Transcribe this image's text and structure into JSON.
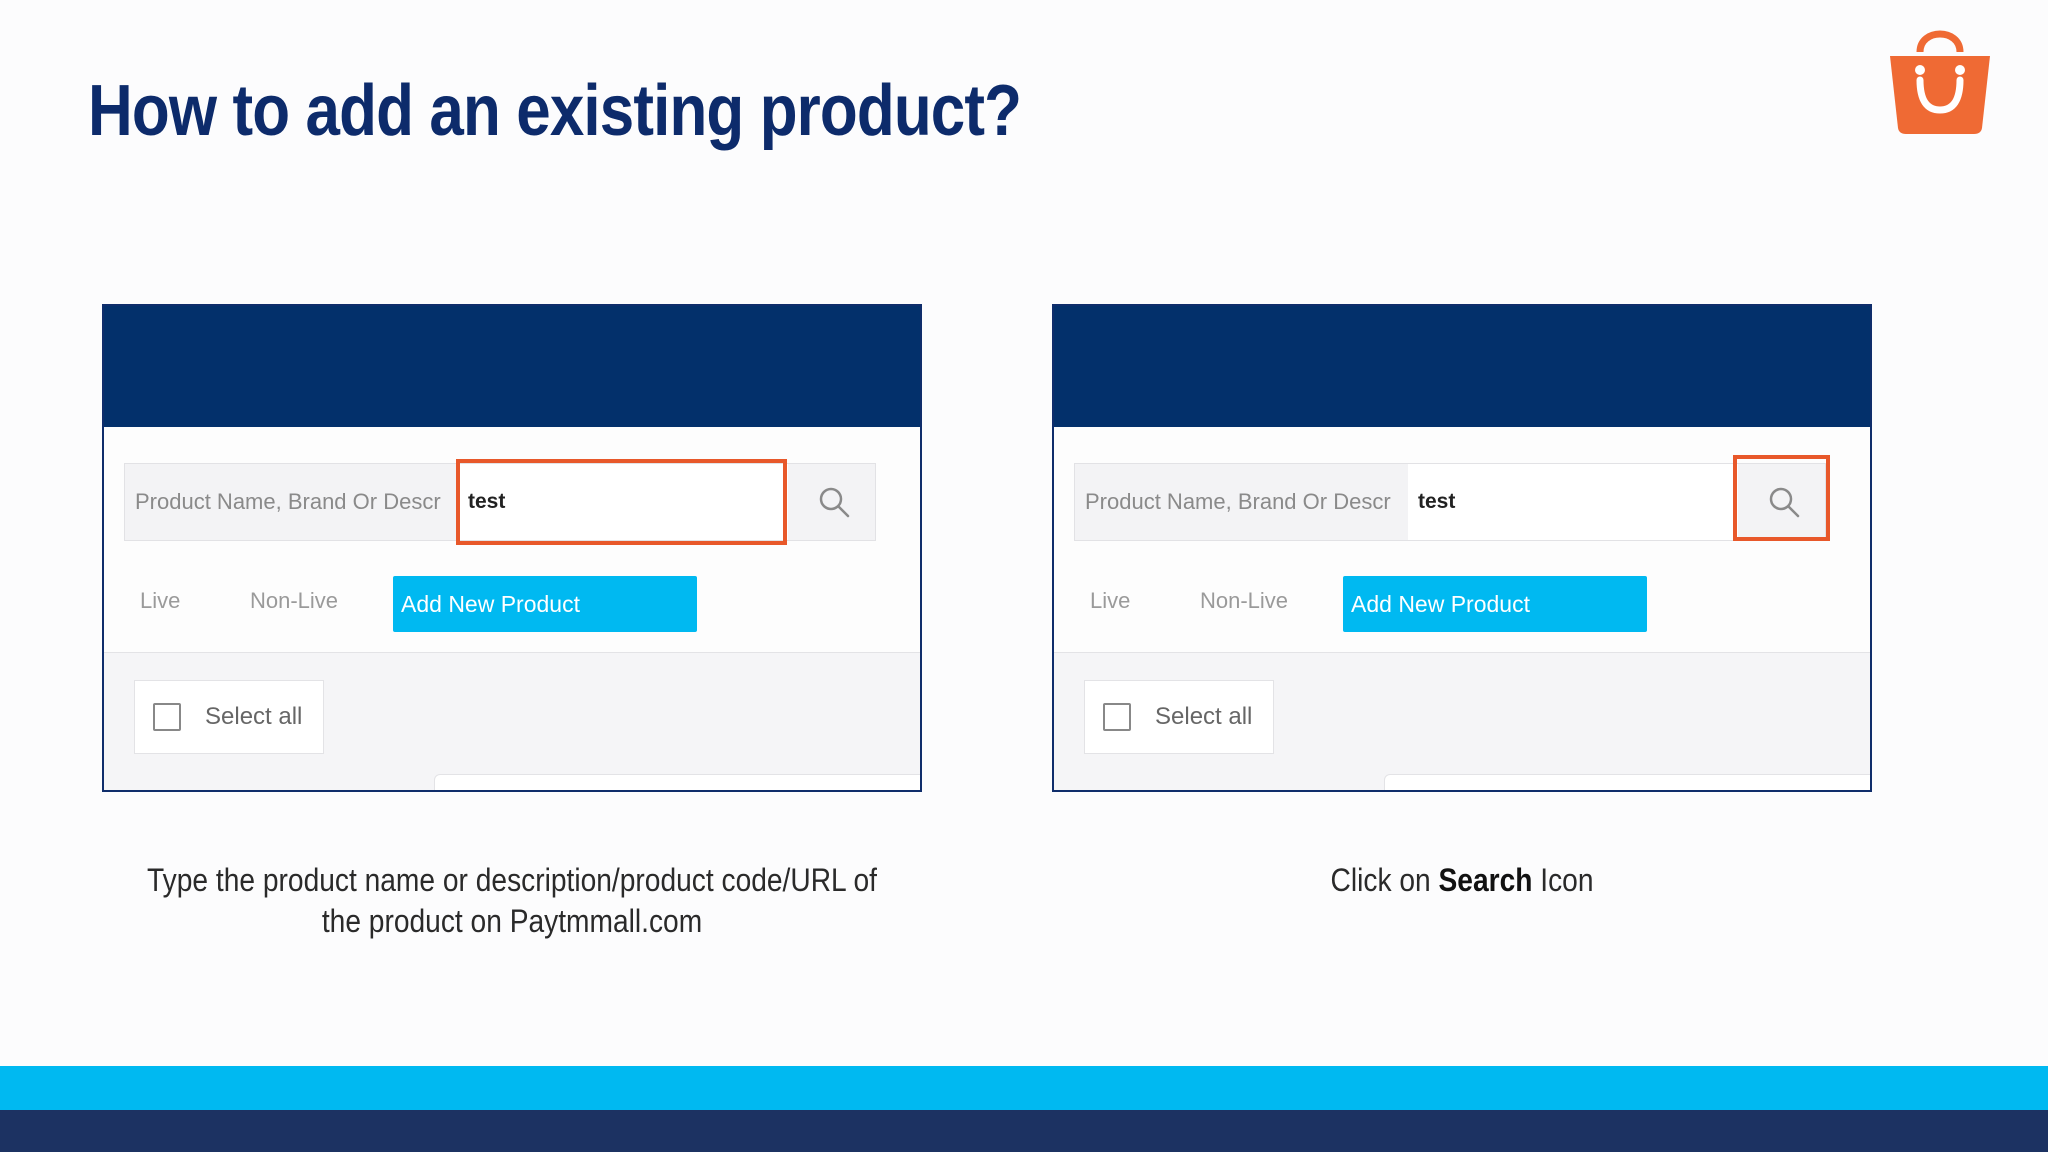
{
  "slide": {
    "title": "How to add an existing product?",
    "colors": {
      "title": "#0d2b6b",
      "accent_orange": "#e8582a",
      "accent_cyan": "#00b9f1",
      "navy": "#1c3262"
    },
    "logo_icon": "shopping-bag-smile-icon"
  },
  "screenshots": [
    {
      "search_placeholder": "Product Name, Brand Or Descr",
      "search_value": "test",
      "search_icon": "search-icon",
      "tabs": [
        "Live",
        "Non-Live"
      ],
      "add_button": "Add New Product",
      "select_all": "Select all",
      "highlighted": "search-input"
    },
    {
      "search_placeholder": "Product Name, Brand Or Descr",
      "search_value": "test",
      "search_icon": "search-icon",
      "tabs": [
        "Live",
        "Non-Live"
      ],
      "add_button": "Add New Product",
      "select_all": "Select all",
      "highlighted": "search-button"
    }
  ],
  "captions": {
    "left": "Type the product name or description/product code/URL of the product on Paytmmall.com",
    "right_prefix": "Click on ",
    "right_bold": "Search",
    "right_suffix": " Icon"
  }
}
